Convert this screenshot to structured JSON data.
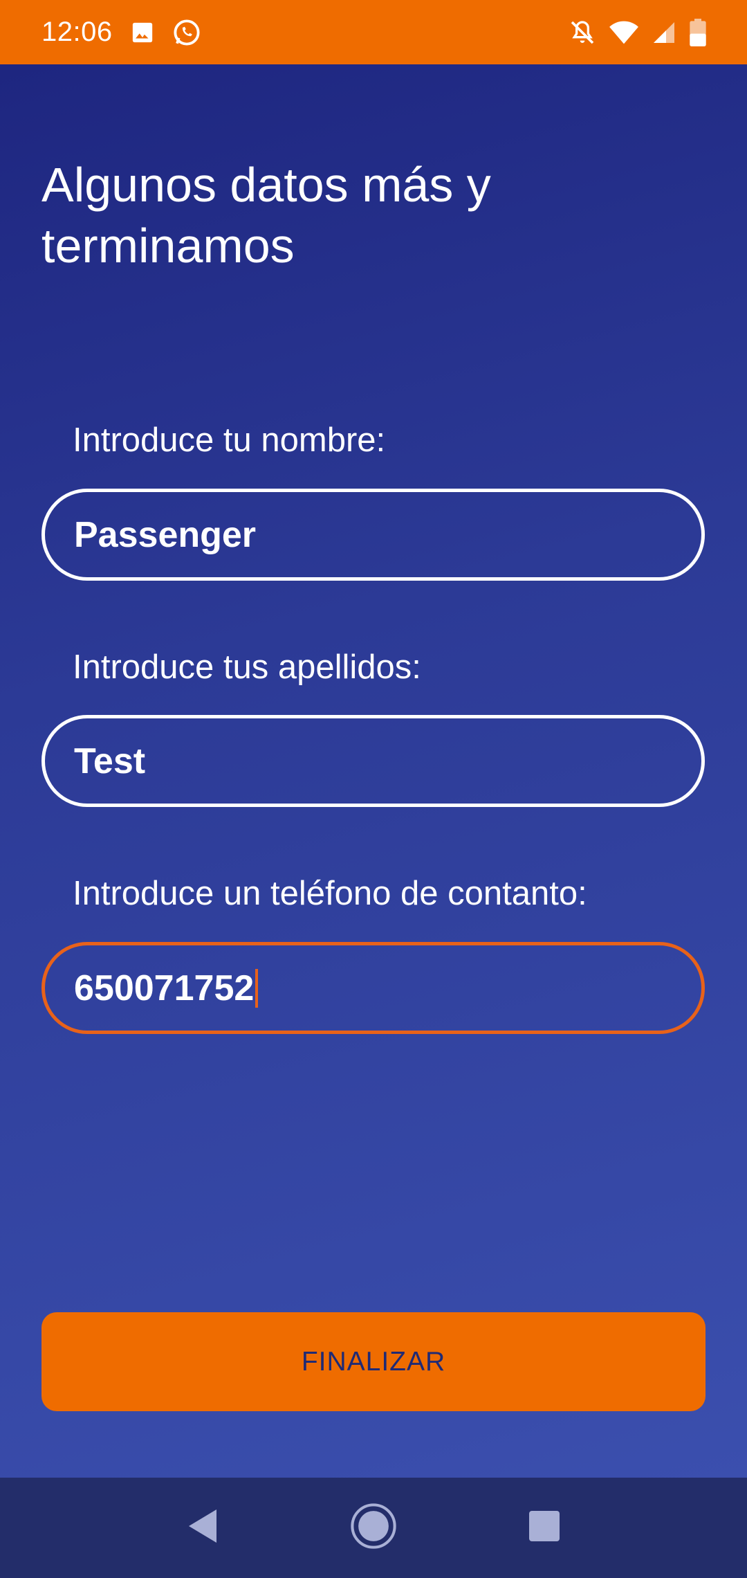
{
  "status_bar": {
    "time": "12:06",
    "background_color": "#ef6c00",
    "left_icons": [
      "image-icon",
      "whatsapp-icon"
    ],
    "right_icons": [
      "notifications-off-icon",
      "wifi-icon",
      "signal-icon",
      "battery-icon"
    ]
  },
  "page": {
    "title": "Algunos datos más y terminamos"
  },
  "form": {
    "name": {
      "label": "Introduce tu nombre:",
      "value": "Passenger"
    },
    "surname": {
      "label": "Introduce tus apellidos:",
      "value": "Test"
    },
    "phone": {
      "label": "Introduce un teléfono de contanto:",
      "value": "650071752",
      "focused": true,
      "focus_color": "#e8621a"
    }
  },
  "actions": {
    "finish_label": "FINALIZAR",
    "finish_color": "#ef6c00"
  },
  "nav_bar": {
    "buttons": [
      "back-icon",
      "home-icon",
      "recents-icon"
    ]
  }
}
